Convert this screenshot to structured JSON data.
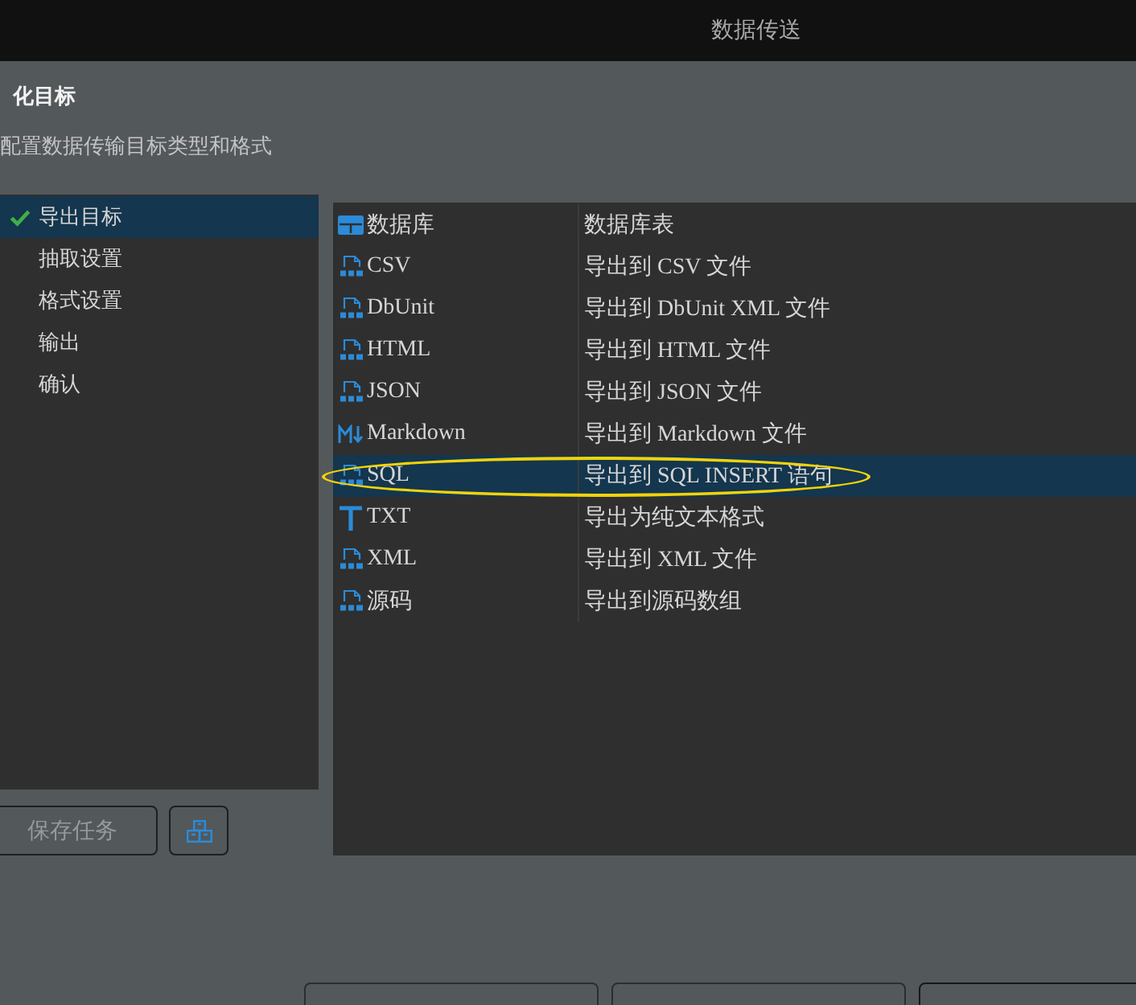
{
  "window": {
    "title": "数据传送"
  },
  "page": {
    "title": "化目标",
    "subtitle": "配置数据传输目标类型和格式"
  },
  "steps": [
    {
      "label": "导出目标",
      "selected": true,
      "done": true
    },
    {
      "label": "抽取设置",
      "selected": false,
      "done": false
    },
    {
      "label": "格式设置",
      "selected": false,
      "done": false
    },
    {
      "label": "输出",
      "selected": false,
      "done": false
    },
    {
      "label": "确认",
      "selected": false,
      "done": false
    }
  ],
  "formats": {
    "rows": [
      {
        "kind": "table",
        "name": "数据库",
        "description": "数据库表",
        "selected": false,
        "circled": false
      },
      {
        "kind": "file",
        "name": "CSV",
        "description": "导出到 CSV 文件",
        "selected": false,
        "circled": false
      },
      {
        "kind": "file",
        "name": "DbUnit",
        "description": "导出到 DbUnit XML 文件",
        "selected": false,
        "circled": false
      },
      {
        "kind": "file",
        "name": "HTML",
        "description": "导出到 HTML 文件",
        "selected": false,
        "circled": false
      },
      {
        "kind": "file",
        "name": "JSON",
        "description": "导出到 JSON 文件",
        "selected": false,
        "circled": false
      },
      {
        "kind": "markdown",
        "name": "Markdown",
        "description": "导出到 Markdown 文件",
        "selected": false,
        "circled": false
      },
      {
        "kind": "file",
        "name": "SQL",
        "description": "导出到 SQL INSERT 语句",
        "selected": true,
        "circled": true
      },
      {
        "kind": "text",
        "name": "TXT",
        "description": "导出为纯文本格式",
        "selected": false,
        "circled": false
      },
      {
        "kind": "file",
        "name": "XML",
        "description": "导出到 XML 文件",
        "selected": false,
        "circled": false
      },
      {
        "kind": "file",
        "name": "源码",
        "description": "导出到源码数组",
        "selected": false,
        "circled": false
      }
    ]
  },
  "task_buttons": [
    {
      "kind": "label",
      "label": "保存任务",
      "disabled": true
    },
    {
      "kind": "icon",
      "disabled": false
    }
  ],
  "footer_buttons": [
    {
      "disabled": true
    },
    {
      "disabled": true
    },
    {
      "disabled": false
    }
  ]
}
